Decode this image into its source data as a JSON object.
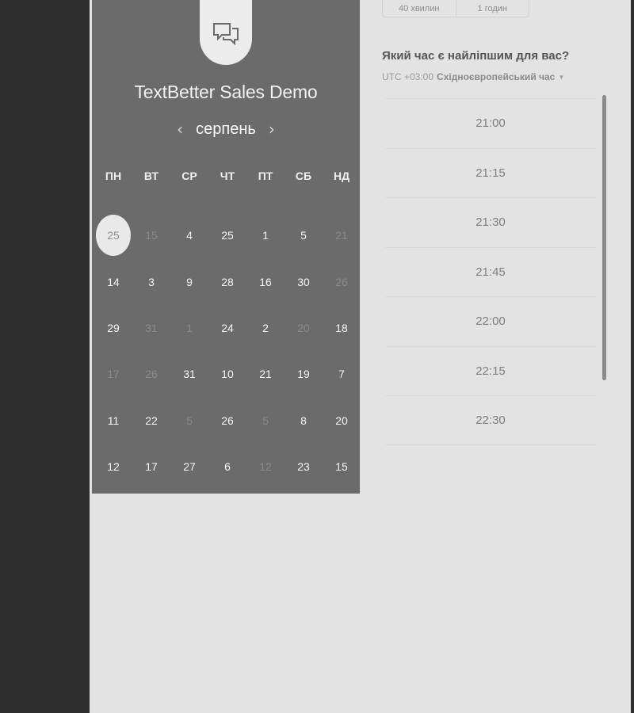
{
  "event": {
    "title": "TextBetter Sales Demo",
    "month": "серпень",
    "prev_arrow": "‹",
    "next_arrow": "›"
  },
  "weekdays": [
    "ПН",
    "ВТ",
    "СР",
    "ЧТ",
    "ПТ",
    "СБ",
    "НД"
  ],
  "days": [
    {
      "d": "25",
      "muted": false,
      "selected": true
    },
    {
      "d": "15",
      "muted": true
    },
    {
      "d": "4",
      "muted": false
    },
    {
      "d": "25",
      "muted": false
    },
    {
      "d": "1",
      "muted": false
    },
    {
      "d": "5",
      "muted": false
    },
    {
      "d": "21",
      "muted": true
    },
    {
      "d": "14",
      "muted": false
    },
    {
      "d": "3",
      "muted": false
    },
    {
      "d": "9",
      "muted": false
    },
    {
      "d": "28",
      "muted": false
    },
    {
      "d": "16",
      "muted": false
    },
    {
      "d": "30",
      "muted": false
    },
    {
      "d": "26",
      "muted": true
    },
    {
      "d": "29",
      "muted": false
    },
    {
      "d": "31",
      "muted": true
    },
    {
      "d": "1",
      "muted": true
    },
    {
      "d": "24",
      "muted": false
    },
    {
      "d": "2",
      "muted": false
    },
    {
      "d": "20",
      "muted": true
    },
    {
      "d": "18",
      "muted": false
    },
    {
      "d": "17",
      "muted": true
    },
    {
      "d": "26",
      "muted": true
    },
    {
      "d": "31",
      "muted": false
    },
    {
      "d": "10",
      "muted": false
    },
    {
      "d": "21",
      "muted": false
    },
    {
      "d": "19",
      "muted": false
    },
    {
      "d": "7",
      "muted": false
    },
    {
      "d": "11",
      "muted": false
    },
    {
      "d": "22",
      "muted": false
    },
    {
      "d": "5",
      "muted": true
    },
    {
      "d": "26",
      "muted": false
    },
    {
      "d": "5",
      "muted": true
    },
    {
      "d": "8",
      "muted": false
    },
    {
      "d": "20",
      "muted": false
    },
    {
      "d": "12",
      "muted": false
    },
    {
      "d": "17",
      "muted": false
    },
    {
      "d": "27",
      "muted": false
    },
    {
      "d": "6",
      "muted": false
    },
    {
      "d": "12",
      "muted": true
    },
    {
      "d": "23",
      "muted": false
    },
    {
      "d": "15",
      "muted": false
    }
  ],
  "durations": [
    "40 хвилин",
    "1 годин"
  ],
  "question": "Який час є найліпшим для вас?",
  "timezone": {
    "offset": "UTC +03:00",
    "name": "Східноєвропейський час",
    "caret": "▼"
  },
  "times": [
    "21:00",
    "21:15",
    "21:30",
    "21:45",
    "22:00",
    "22:15",
    "22:30"
  ],
  "icons": {
    "avatar": "chat-bubbles-icon"
  }
}
